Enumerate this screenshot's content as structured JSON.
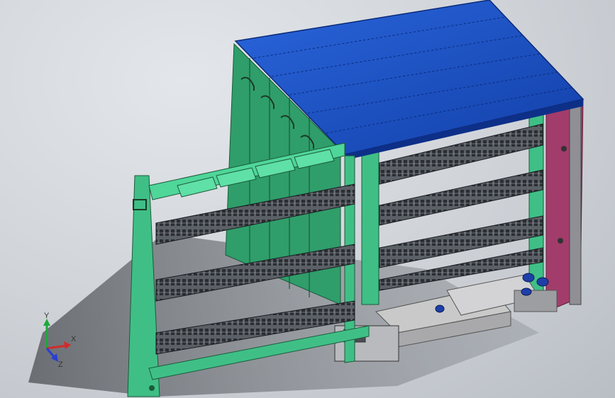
{
  "viewport": {
    "background": "#c9cdd2"
  },
  "model": {
    "roof_color": "#1d55c8",
    "frame_color": "#3fbf86",
    "panel_color": "#2f9e6a",
    "back_panel_color": "#a23c6b",
    "tray_color": "#c9c9c9",
    "bushing_color": "#1e3fa8"
  },
  "triad": {
    "x_label": "X",
    "y_label": "Y",
    "z_label": "Z",
    "x_color": "#d42a2a",
    "y_color": "#1fa83a",
    "z_color": "#2a3fd4"
  }
}
